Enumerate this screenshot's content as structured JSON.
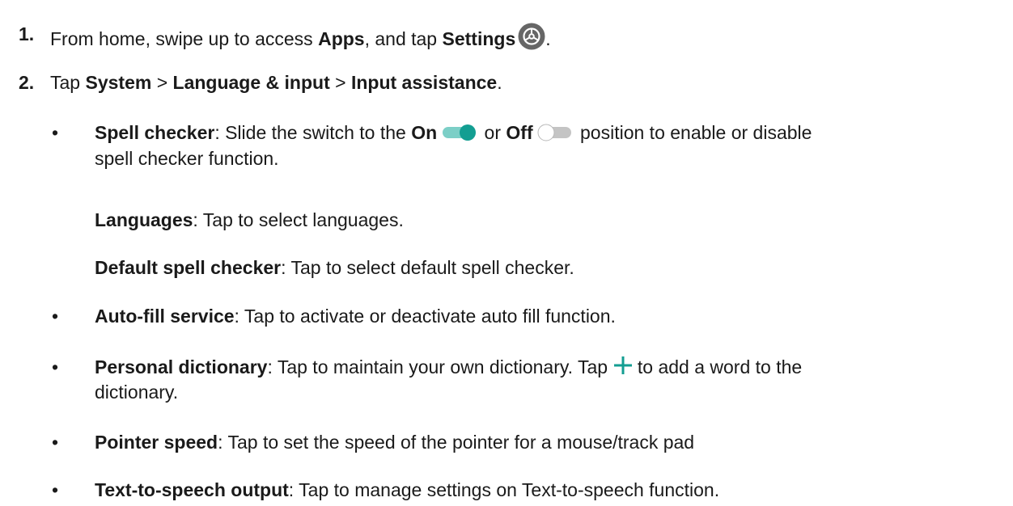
{
  "steps": [
    {
      "number": "1.",
      "t1": "From home, swipe up to access ",
      "b1": "Apps",
      "t2": ", and tap ",
      "b2": "Settings",
      "t3": "."
    },
    {
      "number": "2.",
      "t1": "Tap ",
      "b1": "System",
      "t2": " > ",
      "b2": "Language & input",
      "t3": " > ",
      "b3": "Input assistance",
      "t4": "."
    }
  ],
  "bullet_glyph": "•",
  "spell_checker": {
    "term": "Spell checker",
    "t1": ": Slide the switch to the ",
    "on": "On",
    "t2": " or ",
    "off": "Off",
    "t3": " position to enable or disable",
    "t4": "spell checker function."
  },
  "languages": {
    "term": "Languages",
    "desc": ": Tap to select languages."
  },
  "default_spell_checker": {
    "term": "Default spell checker",
    "desc": ": Tap to select default spell checker."
  },
  "auto_fill": {
    "term": "Auto-fill service",
    "desc": ": Tap to activate or deactivate auto fill function."
  },
  "personal_dictionary": {
    "term": "Personal dictionary",
    "t1": ": Tap to maintain your own dictionary. Tap ",
    "t2": " to add a word to the",
    "t3": "dictionary."
  },
  "pointer_speed": {
    "term": "Pointer speed",
    "desc": ": Tap to set the speed of the pointer for a mouse/track pad"
  },
  "tts_output": {
    "term": "Text-to-speech output",
    "desc": ": Tap to manage settings on Text-to-speech function."
  },
  "icons": {
    "settings": "settings-icon",
    "toggle_on": "toggle-on-icon",
    "toggle_off": "toggle-off-icon",
    "add": "plus-icon"
  },
  "colors": {
    "text": "#1a1a1a",
    "accent": "#139e92",
    "toggle_on_track": "#7ccfc7",
    "toggle_off_track": "#c4c4c4",
    "settings_icon_bg": "#666666"
  }
}
